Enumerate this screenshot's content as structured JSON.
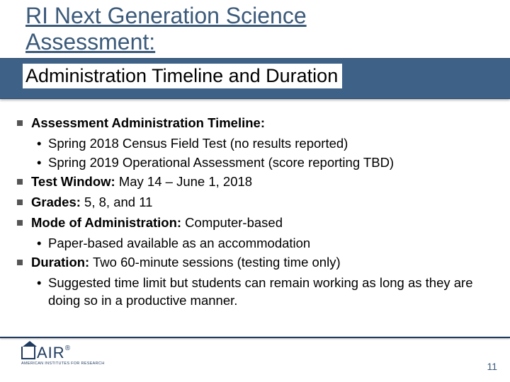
{
  "header": {
    "title_line1": "RI Next Generation Science",
    "title_line2": "Assessment:",
    "subtitle": "Administration Timeline and Duration"
  },
  "bullets": {
    "b1_label": "Assessment  Administration Timeline:",
    "b1_sub1": "Spring 2018 Census Field Test (no results reported)",
    "b1_sub2": "Spring 2019 Operational Assessment (score reporting TBD)",
    "b2_label": "Test Window:",
    "b2_text": "  May 14 – June 1, 2018",
    "b3_label": "Grades:",
    "b3_text": "  5, 8, and 11",
    "b4_label": "Mode of Administration:",
    "b4_text": " Computer-based",
    "b4_sub1": "Paper-based available as an accommodation",
    "b5_label": "Duration:",
    "b5_text": " Two 60-minute sessions (testing time only)",
    "b5_sub1": "Suggested time limit but students can remain working as long as they are doing so in a productive manner."
  },
  "footer": {
    "logo_text": "AIR",
    "logo_sub": "AMERICAN INSTITUTES FOR RESEARCH",
    "page_number": "11"
  }
}
